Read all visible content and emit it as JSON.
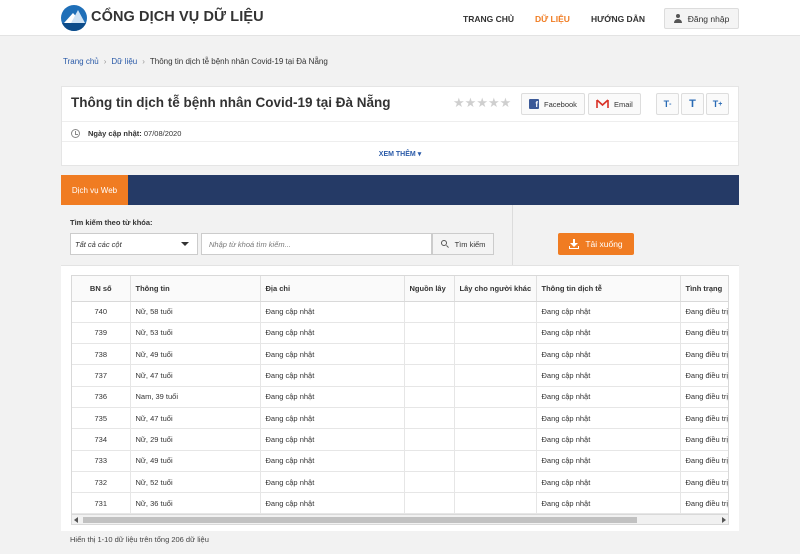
{
  "header": {
    "brand": "CỔNG DỊCH VỤ DỮ LIỆU",
    "nav": [
      {
        "label": "TRANG CHỦ",
        "active": false
      },
      {
        "label": "DỮ LIỆU",
        "active": true
      },
      {
        "label": "HƯỚNG DẪN",
        "active": false
      }
    ],
    "login_label": "Đăng nhập",
    "accent_color": "#f07c22"
  },
  "breadcrumb": {
    "items": [
      "Trang chủ",
      "Dữ liệu"
    ],
    "current": "Thông tin dịch tễ bệnh nhân Covid-19 tại Đà Nẵng"
  },
  "dataset": {
    "title": "Thông tin dịch tễ bệnh nhân Covid-19 tại Đà Nẵng",
    "rating": 0,
    "max_rating": 5,
    "share": {
      "facebook": "Facebook",
      "email": "Email"
    },
    "updated_label": "Ngày cập nhật:",
    "updated_value": "07/08/2020",
    "see_more": "XEM THÊM"
  },
  "service": {
    "tab_label": "Dịch vụ Web",
    "search_label": "Tìm kiếm theo từ khóa:",
    "select_value": "Tất cả các cột",
    "search_placeholder": "Nhập từ khoá tìm kiếm...",
    "search_button": "Tìm kiếm",
    "download_button": "Tải xuống"
  },
  "table": {
    "columns": [
      "BN số",
      "Thông tin",
      "Địa chỉ",
      "Nguồn lây",
      "Lây cho người khác",
      "Thông tin dịch tễ",
      "Tình trạng"
    ],
    "rows": [
      [
        "740",
        "Nữ, 58 tuổi",
        "Đang cập nhật",
        "",
        "",
        "Đang cập nhật",
        "Đang điều trị"
      ],
      [
        "739",
        "Nữ, 53 tuổi",
        "Đang cập nhật",
        "",
        "",
        "Đang cập nhật",
        "Đang điều trị"
      ],
      [
        "738",
        "Nữ, 49 tuổi",
        "Đang cập nhật",
        "",
        "",
        "Đang cập nhật",
        "Đang điều trị"
      ],
      [
        "737",
        "Nữ, 47 tuổi",
        "Đang cập nhật",
        "",
        "",
        "Đang cập nhật",
        "Đang điều trị"
      ],
      [
        "736",
        "Nam, 39 tuổi",
        "Đang cập nhật",
        "",
        "",
        "Đang cập nhật",
        "Đang điều trị"
      ],
      [
        "735",
        "Nữ, 47 tuổi",
        "Đang cập nhật",
        "",
        "",
        "Đang cập nhật",
        "Đang điều trị"
      ],
      [
        "734",
        "Nữ, 29 tuổi",
        "Đang cập nhật",
        "",
        "",
        "Đang cập nhật",
        "Đang điều trị"
      ],
      [
        "733",
        "Nữ, 49 tuổi",
        "Đang cập nhật",
        "",
        "",
        "Đang cập nhật",
        "Đang điều trị"
      ],
      [
        "732",
        "Nữ, 52 tuổi",
        "Đang cập nhật",
        "",
        "",
        "Đang cập nhật",
        "Đang điều trị"
      ],
      [
        "731",
        "Nữ, 36 tuổi",
        "Đang cập nhật",
        "",
        "",
        "Đang cập nhật",
        "Đang điều trị"
      ]
    ],
    "footer": "Hiển thị 1-10 dữ liệu trên tổng 206 dữ liệu"
  }
}
